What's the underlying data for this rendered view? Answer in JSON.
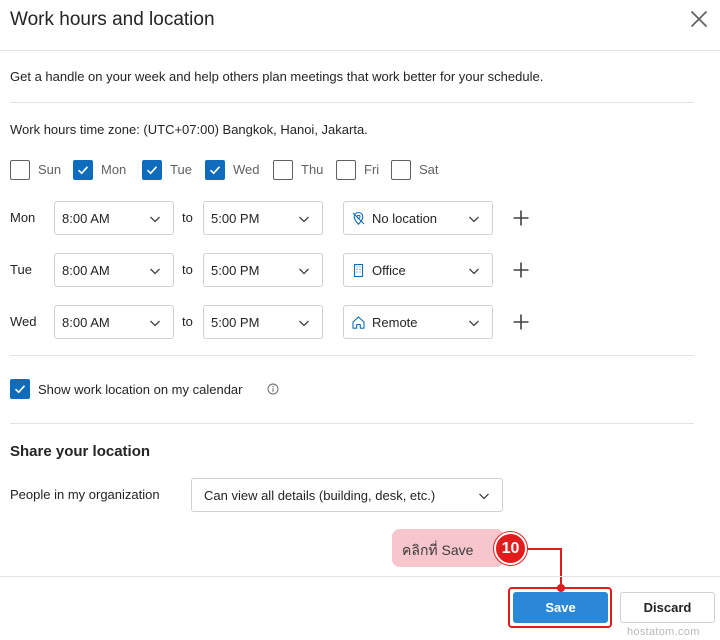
{
  "dialog": {
    "title": "Work hours and location",
    "description": "Get a handle on your week and help others plan meetings that work better for your schedule.",
    "timezone": "Work hours time zone: (UTC+07:00) Bangkok, Hanoi, Jakarta."
  },
  "days": [
    {
      "label": "Sun",
      "checked": false
    },
    {
      "label": "Mon",
      "checked": true
    },
    {
      "label": "Tue",
      "checked": true
    },
    {
      "label": "Wed",
      "checked": true
    },
    {
      "label": "Thu",
      "checked": false
    },
    {
      "label": "Fri",
      "checked": false
    },
    {
      "label": "Sat",
      "checked": false
    }
  ],
  "schedule": {
    "to_label": "to",
    "rows": [
      {
        "day": "Mon",
        "start": "8:00 AM",
        "end": "5:00 PM",
        "location": "No location",
        "location_icon": "no-location-icon"
      },
      {
        "day": "Tue",
        "start": "8:00 AM",
        "end": "5:00 PM",
        "location": "Office",
        "location_icon": "office-building-icon"
      },
      {
        "day": "Wed",
        "start": "8:00 AM",
        "end": "5:00 PM",
        "location": "Remote",
        "location_icon": "home-icon"
      }
    ]
  },
  "show_location": {
    "label": "Show work location on my calendar",
    "checked": true
  },
  "share": {
    "title": "Share your location",
    "people_label": "People in my organization",
    "permission": "Can view all details (building, desk, etc.)"
  },
  "annotation": {
    "callout_text": "คลิกที่ Save",
    "step_number": "10"
  },
  "footer": {
    "save_label": "Save",
    "discard_label": "Discard"
  },
  "watermark": "hostatom.com",
  "colors": {
    "accent": "#0f6cbd",
    "save_button": "#2b88d8",
    "annotation_red": "#e21c1c",
    "callout_pink": "#f7c6cc"
  }
}
